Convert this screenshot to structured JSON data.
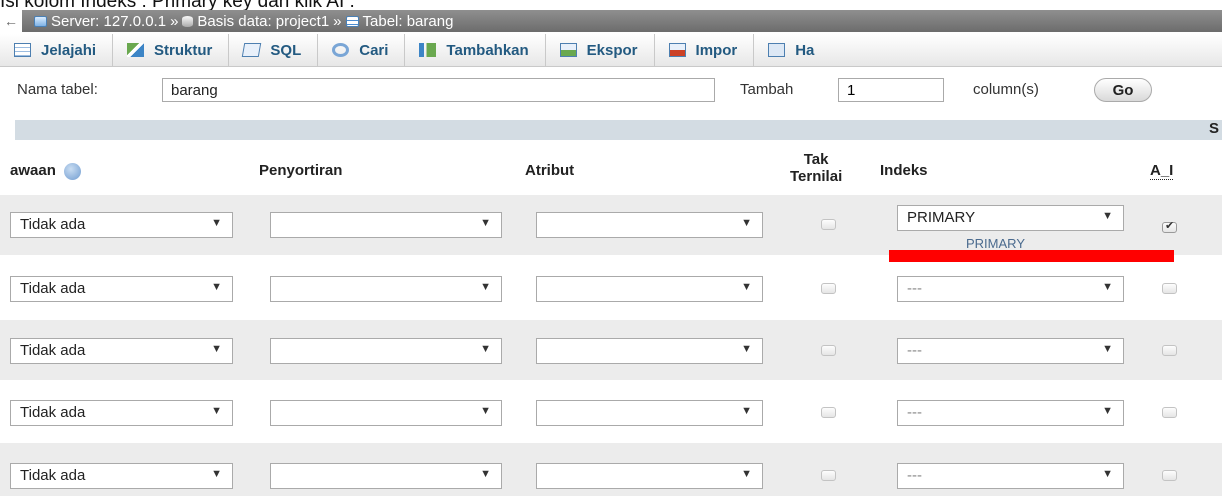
{
  "caption": "Isi kolom Indeks : Primary key dan klik AI :",
  "breadcrumb": {
    "back_icon": "back-arrow-icon",
    "server": "Server: 127.0.0.1",
    "database": "Basis data: project1",
    "table": "Tabel: barang",
    "sep": "»"
  },
  "tabs": [
    {
      "label": "Jelajahi",
      "icon": "browse-icon"
    },
    {
      "label": "Struktur",
      "icon": "structure-icon"
    },
    {
      "label": "SQL",
      "icon": "sql-icon"
    },
    {
      "label": "Cari",
      "icon": "search-icon"
    },
    {
      "label": "Tambahkan",
      "icon": "insert-icon"
    },
    {
      "label": "Ekspor",
      "icon": "export-icon"
    },
    {
      "label": "Impor",
      "icon": "import-icon"
    },
    {
      "label": "Ha",
      "icon": "more-icon"
    }
  ],
  "name_row": {
    "table_name_label": "Nama tabel:",
    "table_name_value": "barang",
    "add_label": "Tambah",
    "add_value": "1",
    "columns_label": "column(s)",
    "go_label": "Go"
  },
  "band_letter": "S",
  "headers": {
    "default": "awaan",
    "collation": "Penyortiran",
    "attributes": "Atribut",
    "null_line1": "Tak",
    "null_line2": "Ternilai",
    "index": "Indeks",
    "ai": "A_I"
  },
  "rows": [
    {
      "default": "Tidak ada",
      "collation": "",
      "attribute": "",
      "null": false,
      "index": "PRIMARY",
      "ai": true,
      "index_hint": "PRIMARY"
    },
    {
      "default": "Tidak ada",
      "collation": "",
      "attribute": "",
      "null": false,
      "index": "---",
      "ai": false
    },
    {
      "default": "Tidak ada",
      "collation": "",
      "attribute": "",
      "null": false,
      "index": "---",
      "ai": false
    },
    {
      "default": "Tidak ada",
      "collation": "",
      "attribute": "",
      "null": false,
      "index": "---",
      "ai": false
    },
    {
      "default": "Tidak ada",
      "collation": "",
      "attribute": "",
      "null": false,
      "index": "---",
      "ai": false
    }
  ],
  "colors": {
    "accent_red": "#ff0000",
    "tab_text": "#235a81",
    "band": "#d3dce3"
  }
}
